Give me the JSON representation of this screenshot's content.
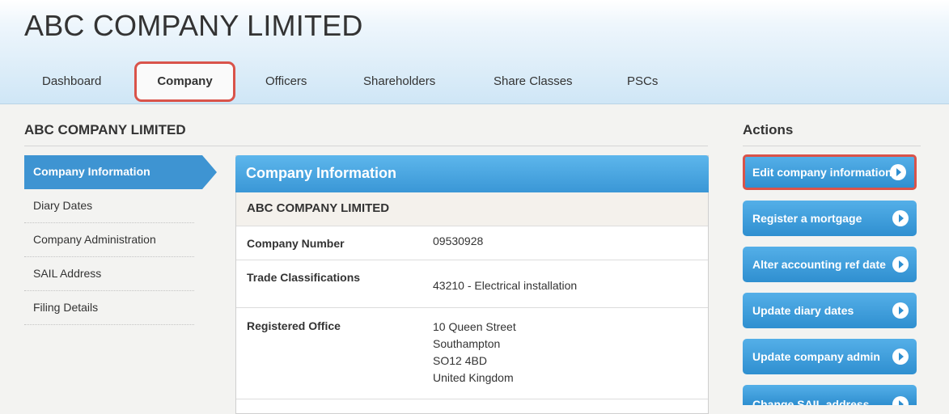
{
  "header": {
    "company_title": "ABC COMPANY LIMITED",
    "tabs": [
      {
        "label": "Dashboard"
      },
      {
        "label": "Company"
      },
      {
        "label": "Officers"
      },
      {
        "label": "Shareholders"
      },
      {
        "label": "Share Classes"
      },
      {
        "label": "PSCs"
      }
    ],
    "active_tab": "Company"
  },
  "page": {
    "heading": "ABC COMPANY LIMITED"
  },
  "sidebar": {
    "items": [
      {
        "label": "Company Information",
        "active": true
      },
      {
        "label": "Diary Dates"
      },
      {
        "label": "Company Administration"
      },
      {
        "label": "SAIL Address"
      },
      {
        "label": "Filing Details"
      }
    ]
  },
  "panel": {
    "title": "Company Information",
    "subtitle": "ABC COMPANY LIMITED",
    "rows": [
      {
        "label": "Company Number",
        "value": "09530928"
      },
      {
        "label": "Trade Classifications",
        "value": "43210 - Electrical installation"
      },
      {
        "label": "Registered Office",
        "address": [
          "10 Queen Street",
          "Southampton",
          "SO12 4BD",
          "United Kingdom"
        ]
      }
    ]
  },
  "actions": {
    "heading": "Actions",
    "buttons": [
      {
        "label": "Edit company information",
        "highlighted": true
      },
      {
        "label": "Register a mortgage"
      },
      {
        "label": "Alter accounting ref date"
      },
      {
        "label": "Update diary dates"
      },
      {
        "label": "Update company admin"
      },
      {
        "label": "Change SAIL address"
      }
    ]
  },
  "colors": {
    "accent_blue": "#3e94d2",
    "highlight_red": "#d9534a",
    "icon": "chevron-right-circle-icon"
  }
}
